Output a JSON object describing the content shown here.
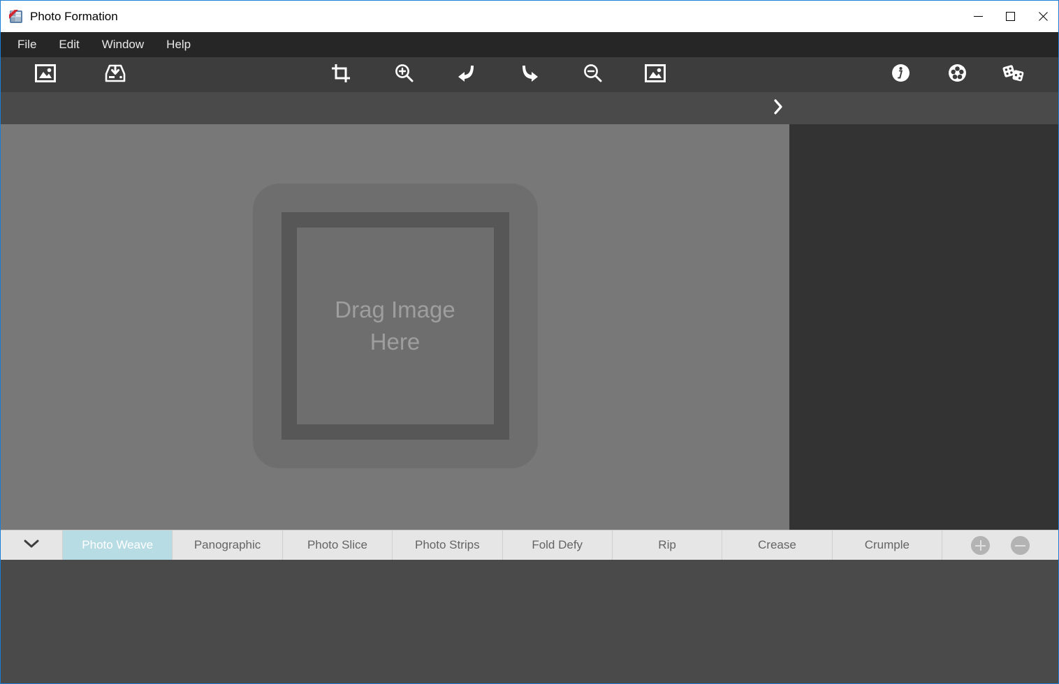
{
  "window": {
    "title": "Photo Formation",
    "app_icon": "photo-formation-app-icon",
    "controls": {
      "minimize": "minimize",
      "maximize": "maximize",
      "close": "close"
    }
  },
  "menubar": {
    "items": [
      {
        "label": "File"
      },
      {
        "label": "Edit"
      },
      {
        "label": "Window"
      },
      {
        "label": "Help"
      }
    ]
  },
  "toolbar": {
    "left": [
      {
        "icon": "open-image-icon",
        "title": "Open Image"
      },
      {
        "icon": "save-image-icon",
        "title": "Save Image"
      }
    ],
    "middle": [
      {
        "icon": "crop-icon",
        "title": "Crop"
      },
      {
        "icon": "zoom-in-icon",
        "title": "Zoom In"
      },
      {
        "icon": "undo-icon",
        "title": "Undo"
      },
      {
        "icon": "redo-icon",
        "title": "Redo"
      },
      {
        "icon": "zoom-out-icon",
        "title": "Zoom Out"
      },
      {
        "icon": "fit-image-icon",
        "title": "Fit Image"
      }
    ],
    "right": [
      {
        "icon": "info-icon",
        "title": "Info"
      },
      {
        "icon": "settings-icon",
        "title": "Settings"
      },
      {
        "icon": "dice-icon",
        "title": "Randomize"
      }
    ]
  },
  "subbar": {
    "expand_icon": "chevron-right-icon"
  },
  "canvas": {
    "dropzone": {
      "icon": "image-placeholder-icon",
      "text": "Drag Image\nHere"
    }
  },
  "tabbar": {
    "collapse_icon": "chevron-down-icon",
    "tabs": [
      {
        "label": "Photo Weave",
        "selected": true
      },
      {
        "label": "Panographic",
        "selected": false
      },
      {
        "label": "Photo Slice",
        "selected": false
      },
      {
        "label": "Photo Strips",
        "selected": false
      },
      {
        "label": "Fold Defy",
        "selected": false
      },
      {
        "label": "Rip",
        "selected": false
      },
      {
        "label": "Crease",
        "selected": false
      },
      {
        "label": "Crumple",
        "selected": false
      }
    ],
    "actions": [
      {
        "icon": "add-icon",
        "title": "Add"
      },
      {
        "icon": "remove-icon",
        "title": "Remove"
      }
    ]
  },
  "colors": {
    "accent": "#1a7fd4",
    "tab_selected": "#b8dce3",
    "toolbar_bg": "#3d3d3d",
    "canvas_bg": "#787878",
    "panel_bg": "#333333"
  }
}
